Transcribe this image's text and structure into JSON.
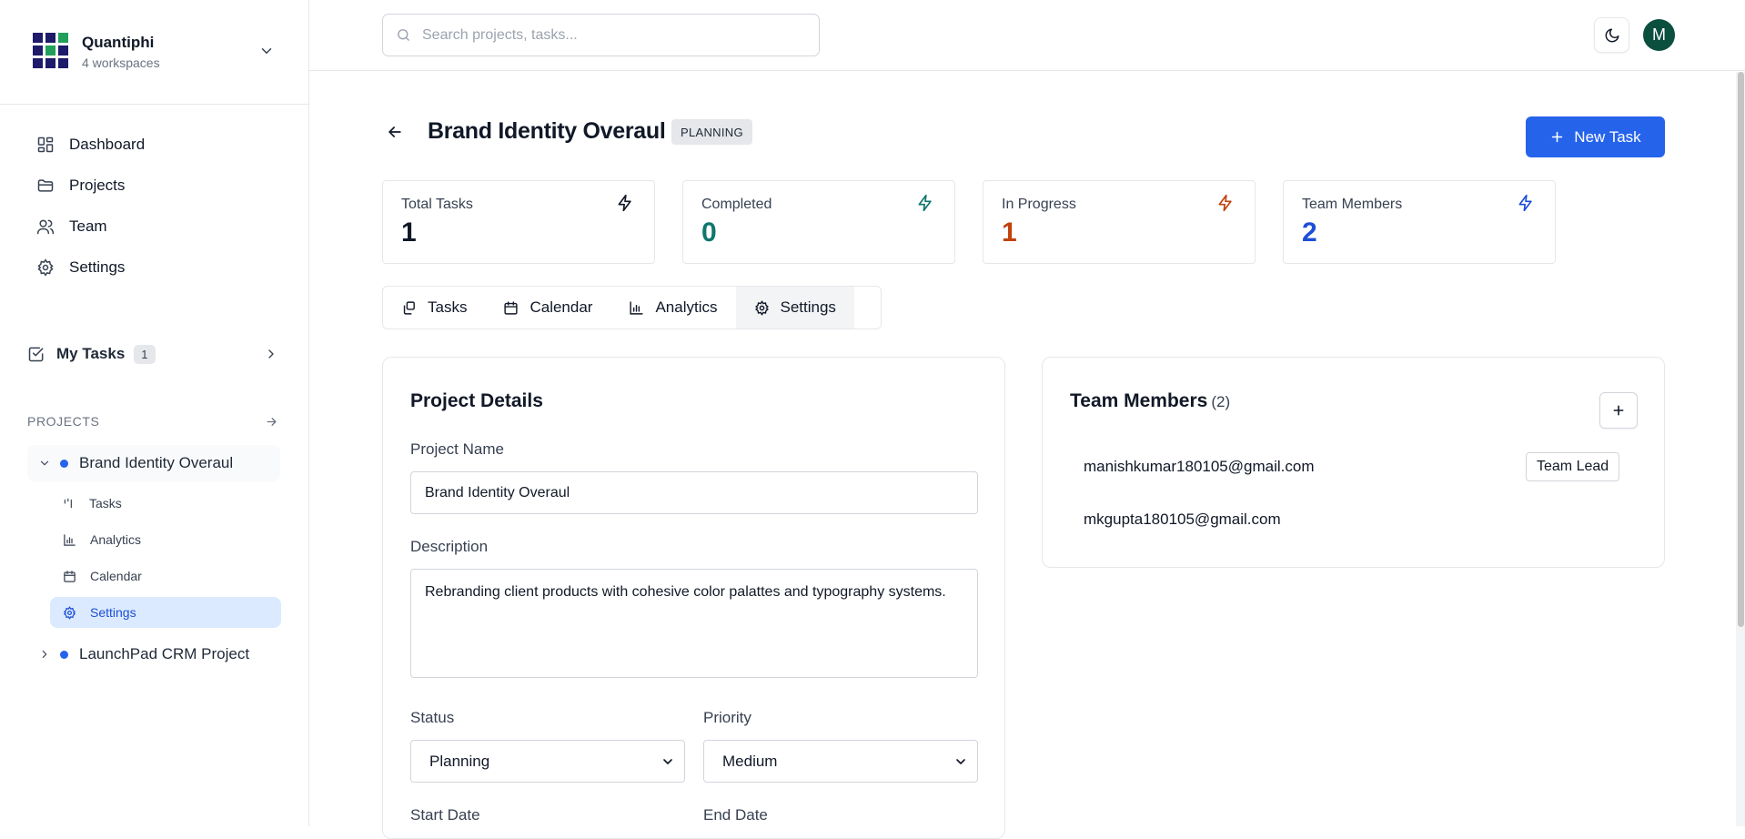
{
  "workspace": {
    "name": "Quantiphi",
    "subtitle": "4 workspaces"
  },
  "nav": [
    {
      "label": "Dashboard",
      "icon": "layout-grid-icon"
    },
    {
      "label": "Projects",
      "icon": "folder-icon"
    },
    {
      "label": "Team",
      "icon": "users-icon"
    },
    {
      "label": "Settings",
      "icon": "gear-icon"
    }
  ],
  "my_tasks": {
    "label": "My Tasks",
    "count": "1"
  },
  "projects_section": {
    "label": "PROJECTS"
  },
  "projects": [
    {
      "name": "Brand Identity Overaul",
      "expanded": true,
      "subitems": [
        "Tasks",
        "Analytics",
        "Calendar",
        "Settings"
      ],
      "active_subitem": "Settings"
    },
    {
      "name": "LaunchPad CRM Project",
      "expanded": false
    }
  ],
  "search": {
    "placeholder": "Search projects, tasks..."
  },
  "user": {
    "initial": "M"
  },
  "page": {
    "title": "Brand Identity Overaul",
    "status": "PLANNING",
    "new_task_label": "New Task"
  },
  "stats": [
    {
      "label": "Total Tasks",
      "value": "1",
      "color": "#111827"
    },
    {
      "label": "Completed",
      "value": "0",
      "color": "#0f766e"
    },
    {
      "label": "In Progress",
      "value": "1",
      "color": "#c2410c"
    },
    {
      "label": "Team Members",
      "value": "2",
      "color": "#1d4ed8"
    }
  ],
  "tabs": [
    {
      "label": "Tasks",
      "icon": "tasks-icon"
    },
    {
      "label": "Calendar",
      "icon": "calendar-icon"
    },
    {
      "label": "Analytics",
      "icon": "bar-chart-icon"
    },
    {
      "label": "Settings",
      "icon": "gear-icon",
      "active": true
    }
  ],
  "details": {
    "title": "Project Details",
    "name_label": "Project Name",
    "name_value": "Brand Identity Overaul",
    "description_label": "Description",
    "description_value": "Rebranding client products with cohesive color palattes and typography systems.",
    "status_label": "Status",
    "status_value": "Planning",
    "priority_label": "Priority",
    "priority_value": "Medium",
    "start_label": "Start Date",
    "end_label": "End Date"
  },
  "team": {
    "title": "Team Members",
    "count": "(2)",
    "members": [
      {
        "email": "manishkumar180105@gmail.com",
        "role": "Team Lead"
      },
      {
        "email": "mkgupta180105@gmail.com",
        "role": ""
      }
    ]
  },
  "colors": {
    "accent": "#2563eb",
    "avatar": "#0b4f3f",
    "active_bg": "#dbeafe"
  }
}
